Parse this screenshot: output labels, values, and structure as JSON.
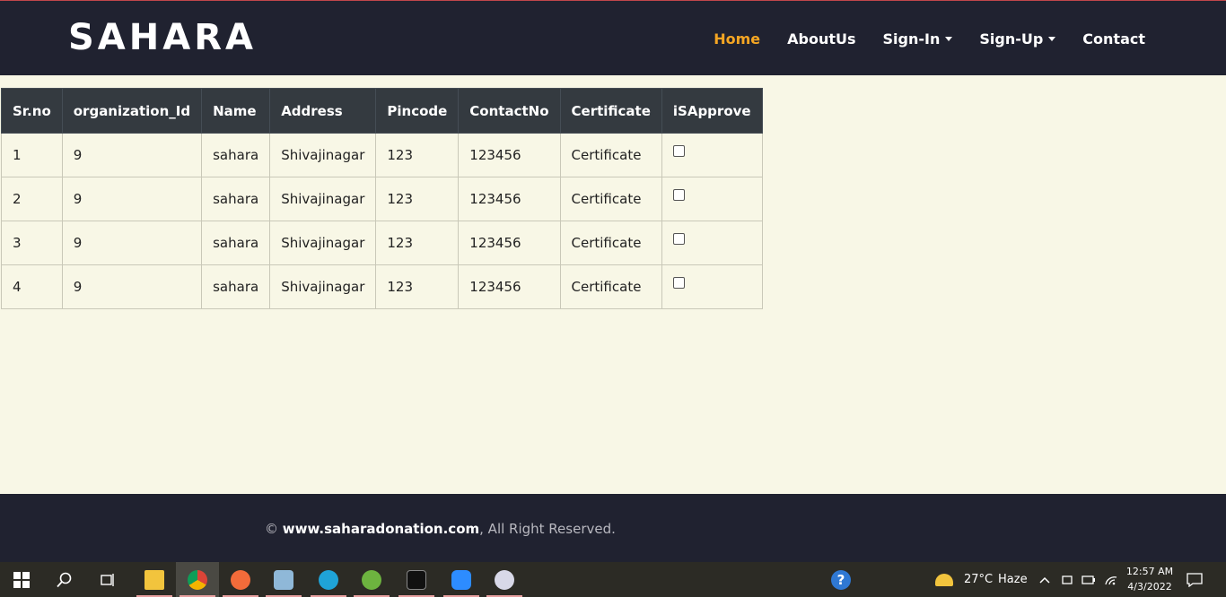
{
  "navbar": {
    "brand": "SAHARA",
    "items": [
      {
        "label": "Home",
        "active": true
      },
      {
        "label": "AboutUs"
      },
      {
        "label": "Sign-In",
        "dropdown": true
      },
      {
        "label": "Sign-Up",
        "dropdown": true
      },
      {
        "label": "Contact"
      }
    ]
  },
  "table": {
    "headers": [
      "Sr.no",
      "organization_Id",
      "Name",
      "Address",
      "Pincode",
      "ContactNo",
      "Certificate",
      "iSApprove"
    ],
    "rows": [
      [
        "1",
        "9",
        "sahara",
        "Shivajinagar",
        "123",
        "123456",
        "Certificate"
      ],
      [
        "2",
        "9",
        "sahara",
        "Shivajinagar",
        "123",
        "123456",
        "Certificate"
      ],
      [
        "3",
        "9",
        "sahara",
        "Shivajinagar",
        "123",
        "123456",
        "Certificate"
      ],
      [
        "4",
        "9",
        "sahara",
        "Shivajinagar",
        "123",
        "123456",
        "Certificate"
      ]
    ],
    "approved": [
      false,
      false,
      false,
      false
    ]
  },
  "footer": {
    "copyright": "©",
    "site": "www.saharadonation.com",
    "suffix": ", All Right Reserved."
  },
  "taskbar": {
    "weather_temp": "27°C",
    "weather_desc": "Haze",
    "time": "12:57 AM",
    "date": "4/3/2022",
    "colors": {
      "accent": "#f5a623",
      "nav_bg": "#202230",
      "page_bg": "#f8f7e6"
    }
  }
}
